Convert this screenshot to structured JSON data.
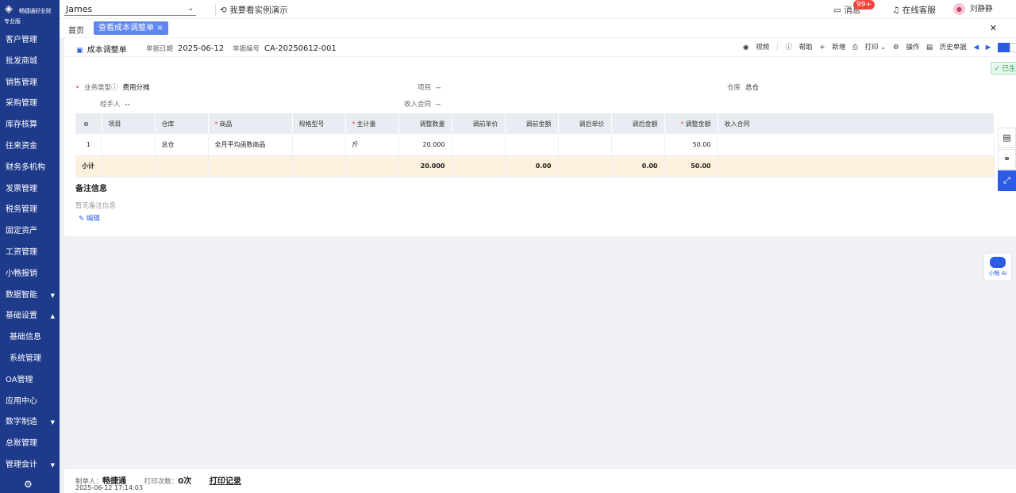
{
  "brand": {
    "name": "畅捷通好业财",
    "edition": "专业版"
  },
  "nav": [
    {
      "label": "客户管理"
    },
    {
      "label": "批发商城"
    },
    {
      "label": "销售管理"
    },
    {
      "label": "采购管理"
    },
    {
      "label": "库存核算"
    },
    {
      "label": "往来资金"
    },
    {
      "label": "财务多机构"
    },
    {
      "label": "发票管理"
    },
    {
      "label": "税务管理"
    },
    {
      "label": "固定资产"
    },
    {
      "label": "工资管理"
    },
    {
      "label": "小畅报销"
    },
    {
      "label": "数据智能",
      "caret": "▼"
    },
    {
      "label": "基础设置",
      "caret": "▲"
    },
    {
      "label": "基础信息",
      "sub": true
    },
    {
      "label": "系统管理",
      "sub": true
    },
    {
      "label": "OA管理"
    },
    {
      "label": "应用中心"
    },
    {
      "label": "数字制造",
      "caret": "▼"
    },
    {
      "label": "总账管理"
    },
    {
      "label": "管理会计",
      "caret": "▼"
    }
  ],
  "topbar": {
    "account": "James",
    "demo": "我要看实例演示",
    "messages": "消息",
    "badge": "99+",
    "service": "在线客服",
    "user": "刘静静"
  },
  "tabs": {
    "home": "首页",
    "active": "查看成本调整单"
  },
  "doc": {
    "tab": "成本调整单",
    "date_label": "单据日期",
    "date": "2025-06-12",
    "no_label": "单据编号",
    "no": "CA-20250612-001",
    "status": "已生效",
    "tools": {
      "video": "视频",
      "help": "帮助",
      "add": "新增",
      "print": "打印",
      "ops": "操作",
      "history": "历史单据"
    },
    "fields": {
      "biz_type_label": "业务类型",
      "biz_type": "费用分摊",
      "project_label": "项目",
      "project": "--",
      "warehouse_label": "仓库",
      "warehouse": "总仓",
      "handler_label": "经手人",
      "handler": "--",
      "contract_label": "收入合同",
      "contract": "--"
    },
    "columns": [
      "项目",
      "仓库",
      "商品",
      "规格型号",
      "主计量",
      "调整数量",
      "调前单价",
      "调前金额",
      "调后单价",
      "调后金额",
      "调整金额",
      "收入合同"
    ],
    "rows": [
      {
        "idx": "1",
        "project": "",
        "warehouse": "总仓",
        "product": "全月平均函数商品",
        "spec": "",
        "unit": "斤",
        "qty": "20.000",
        "pre_price": "",
        "pre_amt": "",
        "post_price": "",
        "post_amt": "",
        "adj_amt": "50.00",
        "contract": ""
      }
    ],
    "subtotal": {
      "label": "小计",
      "qty": "20.000",
      "pre_amt": "0.00",
      "post_amt": "0.00",
      "adj_amt": "50.00"
    },
    "remark": {
      "title": "备注信息",
      "empty": "暂无备注信息",
      "edit": "编辑"
    }
  },
  "footer": {
    "maker_label": "制单人：",
    "maker": "畅捷通",
    "print_label": "打印次数：",
    "print_count": "0次",
    "print_log": "打印记录",
    "timestamp": "2025-06-12 17:14:03"
  },
  "ai": {
    "label": "小畅 AI"
  }
}
